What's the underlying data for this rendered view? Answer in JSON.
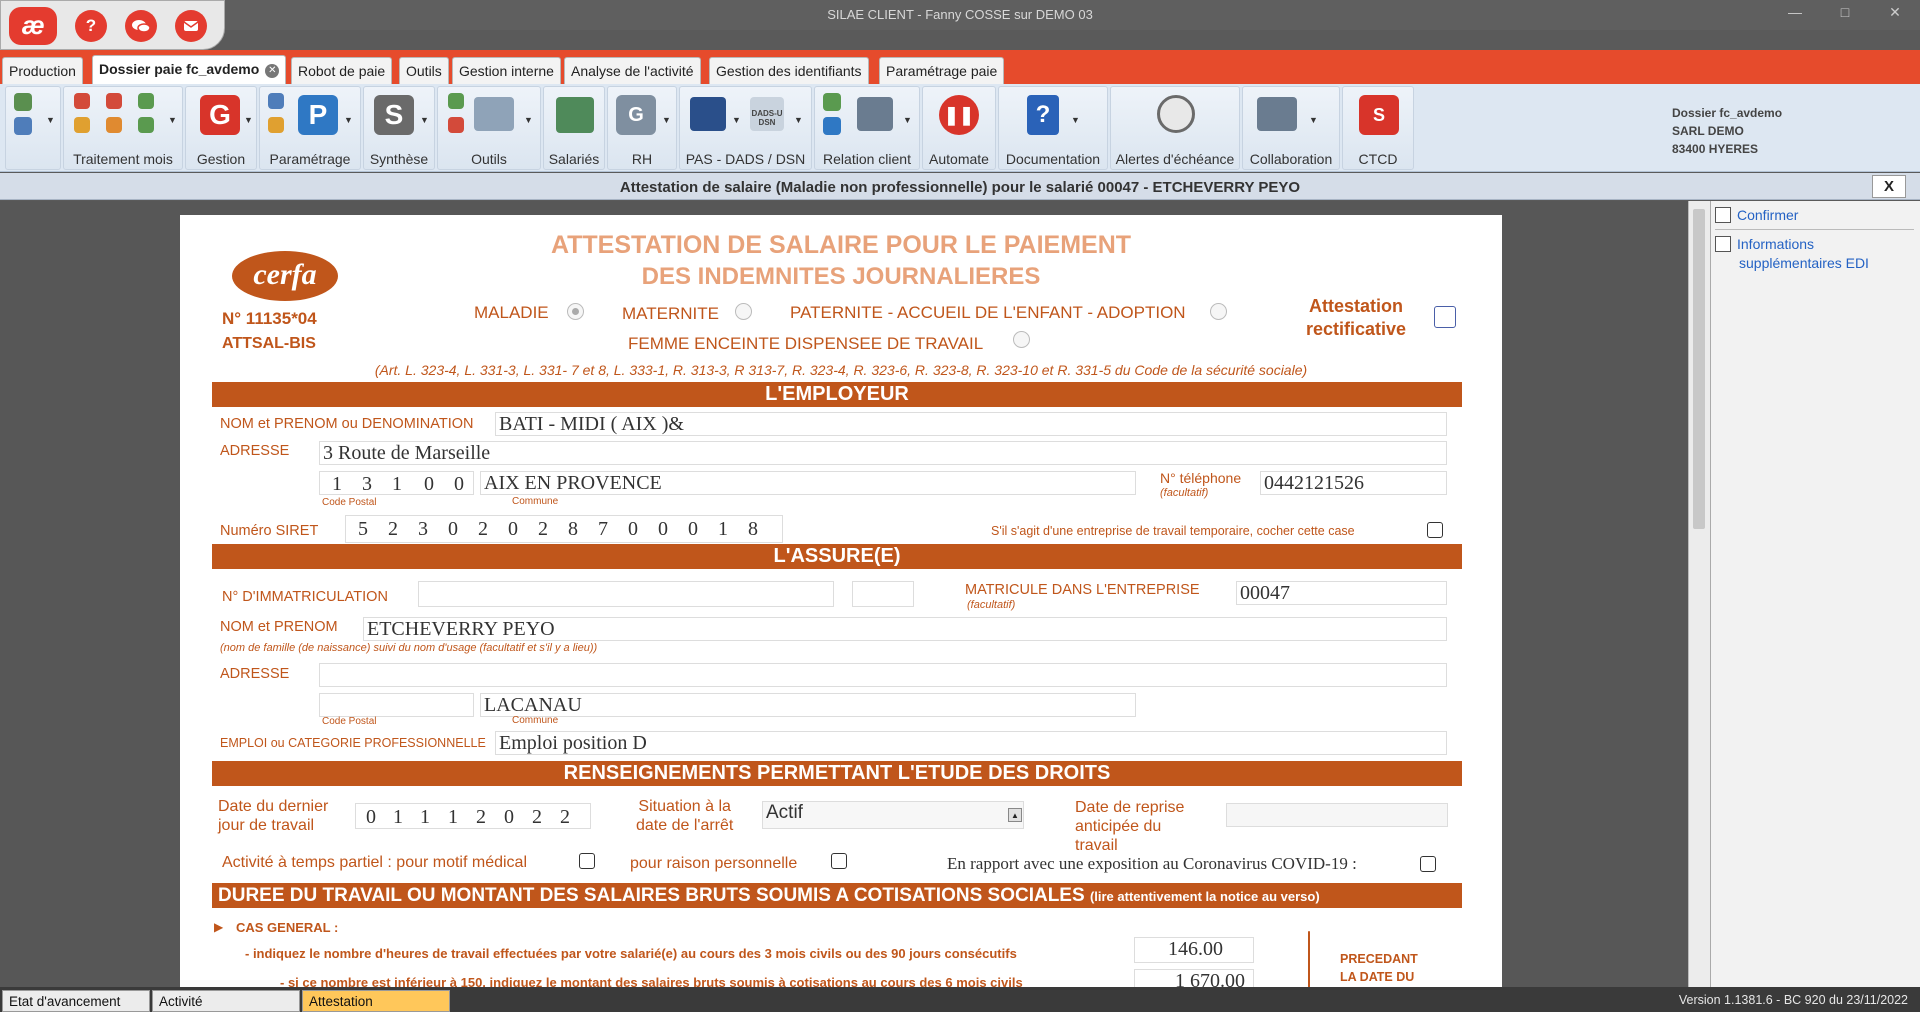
{
  "window": {
    "title": "SILAE CLIENT - Fanny COSSE sur DEMO 03"
  },
  "quick": {
    "logo": "æ",
    "help": "?",
    "chat": "chat-icon",
    "mail": "mail-icon"
  },
  "tabs": [
    "Production",
    "Dossier paie fc_avdemo",
    "Robot de paie",
    "Outils",
    "Gestion interne",
    "Analyse de l'activité",
    "Gestion des identifiants",
    "Paramétrage paie"
  ],
  "ribbon": {
    "groups": [
      "Traitement mois",
      "Gestion",
      "Paramétrage",
      "Synthèse",
      "Outils",
      "Salariés",
      "RH",
      "PAS - DADS / DSN",
      "Relation client",
      "Automate",
      "Documentation",
      "Alertes d'échéance",
      "Collaboration",
      "CTCD"
    ],
    "icon_letters": {
      "gestion": "G",
      "parametrage": "P",
      "synthese": "S",
      "rh": "G",
      "dsn": "DADS-U DSN",
      "ctcd": "S"
    }
  },
  "dossier": {
    "line1": "Dossier fc_avdemo",
    "line2": "SARL DEMO",
    "line3": "83400 HYERES"
  },
  "subheader": {
    "title": "Attestation de salaire (Maladie non professionnelle) pour le salarié 00047 - ETCHEVERRY PEYO",
    "close": "X"
  },
  "right_panel": {
    "confirm": "Confirmer",
    "info_line1": "Informations",
    "info_line2": "supplémentaires EDI"
  },
  "form": {
    "logo": "cerfa",
    "number": "N° 11135*04",
    "code": "ATTSAL-BIS",
    "title1": "ATTESTATION DE SALAIRE POUR LE PAIEMENT",
    "title2": "DES INDEMNITES JOURNALIERES",
    "maladie": "MALADIE",
    "maternite": "MATERNITE",
    "paternite": "PATERNITE - ACCUEIL DE L'ENFANT - ADOPTION",
    "femme": "FEMME ENCEINTE DISPENSEE DE TRAVAIL",
    "rectif1": "Attestation",
    "rectif2": "rectificative",
    "articles": "(Art. L. 323-4, L. 331-3,  L. 331- 7 et 8,  L. 333-1, R. 313-3, R 313-7, R. 323-4, R. 323-6, R. 323-8, R. 323-10 et R. 331-5 du Code de la  sécurité sociale)",
    "section_employeur": "L'EMPLOYEUR",
    "nom_label": "NOM et PRENOM ou DENOMINATION",
    "nom_value": "BATI - MIDI   ( AIX )&",
    "adresse_label": "ADRESSE",
    "adresse_value": "3 Route de Marseille",
    "cp_digits": [
      "1",
      "3",
      "1",
      "0",
      "0"
    ],
    "commune_value": "AIX EN PROVENCE",
    "code_postal_small": "Code Postal",
    "commune_small": "Commune",
    "tel_label": "N° téléphone",
    "tel_small": "(facultatif)",
    "tel_value": "0442121526",
    "siret_label": "Numéro SIRET",
    "siret_digits": [
      "5",
      "2",
      "3",
      "0",
      "2",
      "0",
      "2",
      "8",
      "7",
      "0",
      "0",
      "0",
      "1",
      "8"
    ],
    "interim_label": "S'il s'agit d'une entreprise de travail temporaire, cocher cette case",
    "section_assure": "L'ASSURE(E)",
    "immat_label": "N° D'IMMATRICULATION",
    "matricule_label": "MATRICULE DANS L'ENTREPRISE",
    "matricule_small": "(facultatif)",
    "matricule_value": "00047",
    "assure_nom_label": "NOM et PRENOM",
    "assure_nom_value": "ETCHEVERRY PEYO",
    "assure_nom_note": "(nom de famille (de naissance) suivi du nom d'usage (facultatif et s'il y a lieu))",
    "assure_adresse_label": "ADRESSE",
    "assure_commune_value": "LACANAU",
    "emploi_label": "EMPLOI  ou CATEGORIE PROFESSIONNELLE",
    "emploi_value": "Emploi position D",
    "section_droits": "RENSEIGNEMENTS PERMETTANT L'ETUDE DES DROITS",
    "dernier_jour_l1": "Date du dernier",
    "dernier_jour_l2": "jour de travail",
    "dernier_jour_digits": [
      "0",
      "1",
      "1",
      "1",
      "2",
      "0",
      "2",
      "2"
    ],
    "situation_l1": "Situation à la",
    "situation_l2": "date de l'arrêt",
    "situation_value": "Actif",
    "reprise_l1": "Date de reprise",
    "reprise_l2": "anticipée du",
    "reprise_l3": "travail",
    "temps_partiel": "Activité à temps partiel : pour motif médical",
    "raison_perso": "pour raison personnelle",
    "covid": "En rapport avec une exposition au Coronavirus COVID-19 :",
    "section_duree": "DUREE DU TRAVAIL OU MONTANT DES SALAIRES BRUTS SOUMIS A COTISATIONS SOCIALES",
    "section_duree_note": "(lire attentivement la notice au verso)",
    "cas_general": "CAS GENERAL :",
    "indiquez": "- indiquez le nombre d'heures de travail effectuées par votre salarié(e) au cours des 3 mois civils ou des 90 jours consécutifs",
    "heures_value": "146.00",
    "si_inferieur": "- si ce nombre est inférieur à 150, indiquez le montant des salaires bruts soumis à cotisations au cours des 6 mois civils",
    "montant_value": "1 670.00",
    "precedant_l1": "PRECEDANT",
    "precedant_l2": "LA DATE DU"
  },
  "bottom": {
    "tabs": [
      "Etat d'avancement",
      "Activité",
      "Attestation"
    ],
    "version": "Version 1.1381.6 - BC 920 du 23/11/2022"
  },
  "colors": {
    "brand_red": "#e43b2f",
    "tab_strip": "#e64b2c",
    "form_orange": "#c0561b",
    "active_bottom_tab": "#ffc75a"
  }
}
